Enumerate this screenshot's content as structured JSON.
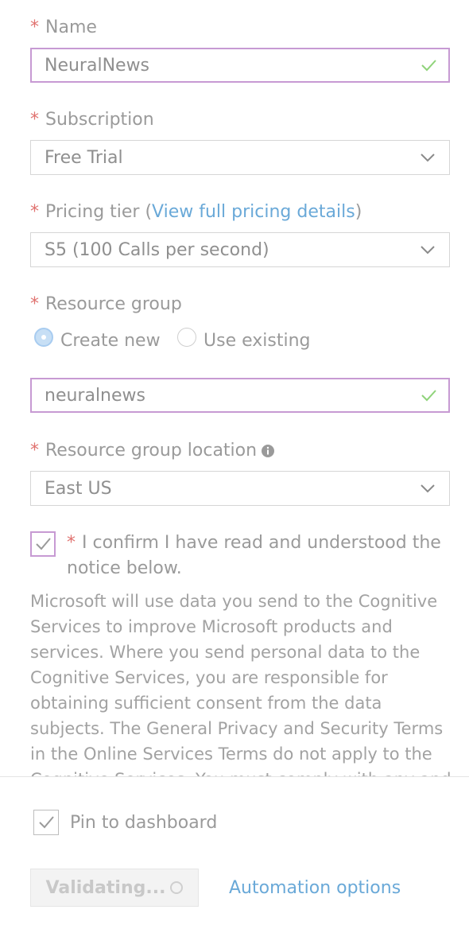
{
  "required_marker": "*",
  "name": {
    "label": "Name",
    "value": "NeuralNews"
  },
  "subscription": {
    "label": "Subscription",
    "value": "Free Trial"
  },
  "pricing": {
    "label_prefix": "Pricing tier (",
    "link": "View full pricing details",
    "label_suffix": ")",
    "value": "S5 (100 Calls per second)"
  },
  "resource_group": {
    "label": "Resource group",
    "options": {
      "create_new": "Create new",
      "use_existing": "Use existing"
    },
    "selected": "create_new",
    "value": "neuralnews"
  },
  "location": {
    "label": "Resource group location",
    "value": "East US"
  },
  "confirm": {
    "checked": true,
    "line1": "I confirm I have read and understood the",
    "line2": "notice below."
  },
  "notice_text": "Microsoft will use data you send to the Cognitive Services to improve Microsoft products and services. Where you send personal data to the Cognitive Services, you are responsible for obtaining sufficient consent from the data subjects. The General Privacy and Security Terms in the Online Services Terms do not apply to the Cognitive Services. You must comply with any and",
  "pin": {
    "checked": true,
    "label": "Pin to dashboard"
  },
  "footer": {
    "validate_label": "Validating...",
    "automation_label": "Automation options"
  },
  "colors": {
    "valid_border": "#c79ad3",
    "check_green": "#8fd37a",
    "link_blue": "#6aa9d8",
    "required_red": "#e0726f"
  }
}
